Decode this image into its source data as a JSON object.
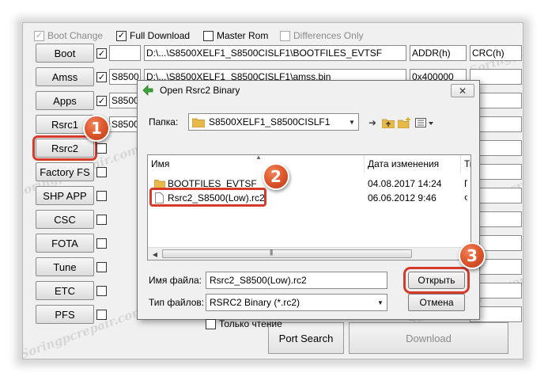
{
  "watermark": "Soringpcrepair.com",
  "options": [
    {
      "label": "Boot Change",
      "checked": true,
      "enabled": false
    },
    {
      "label": "Full Download",
      "checked": true,
      "enabled": true
    },
    {
      "label": "Master Rom",
      "checked": false,
      "enabled": true
    },
    {
      "label": "Differences Only",
      "checked": false,
      "enabled": false
    }
  ],
  "check_mark": "✓",
  "rows": [
    {
      "button": "Boot",
      "checked": true,
      "prefix": "",
      "path": "D:\\...\\S8500XELF1_S8500CISLF1\\BOOTFILES_EVTSF",
      "col_a": "ADDR(h)",
      "col_b": "CRC(h)"
    },
    {
      "button": "Amss",
      "checked": true,
      "prefix": "S8500",
      "path": "D:\\...\\S8500XELF1_S8500CISLF1\\amss.bin",
      "col_a": "0x400000",
      "col_b": ""
    },
    {
      "button": "Apps",
      "checked": true,
      "prefix": "S8500",
      "path": "",
      "col_a": "",
      "col_b": ""
    },
    {
      "button": "Rsrc1",
      "checked": false,
      "prefix": "S8500",
      "path": "",
      "col_a": "",
      "col_b": ""
    },
    {
      "button": "Rsrc2",
      "checked": false,
      "prefix": "",
      "path": "",
      "col_a": "",
      "col_b": ""
    },
    {
      "button": "Factory FS",
      "checked": false,
      "prefix": "",
      "path": "",
      "col_a": "",
      "col_b": ""
    },
    {
      "button": "SHP APP",
      "checked": false,
      "prefix": "",
      "path": "",
      "col_a": "",
      "col_b": ""
    },
    {
      "button": "CSC",
      "checked": false,
      "prefix": "",
      "path": "",
      "col_a": "",
      "col_b": ""
    },
    {
      "button": "FOTA",
      "checked": false,
      "prefix": "",
      "path": "",
      "col_a": "",
      "col_b": ""
    },
    {
      "button": "Tune",
      "checked": false,
      "prefix": "",
      "path": "",
      "col_a": "",
      "col_b": ""
    },
    {
      "button": "ETC",
      "checked": false,
      "prefix": "",
      "path": "",
      "col_a": "",
      "col_b": ""
    },
    {
      "button": "PFS",
      "checked": false,
      "prefix": "",
      "path": "",
      "col_a": "",
      "col_b": ""
    }
  ],
  "bottom_buttons": {
    "port_search": "Port Search",
    "download": "Download"
  },
  "dialog": {
    "title": "Open Rsrc2 Binary",
    "close": "✕",
    "folder_label": "Папка:",
    "folder_value": "S8500XELF1_S8500CISLF1",
    "columns": {
      "name": "Имя",
      "date": "Дата изменения",
      "type": "Ти"
    },
    "files": [
      {
        "name": "BOOTFILES_EVTSF",
        "date": "04.08.2017 14:24",
        "type": "П",
        "kind": "folder"
      },
      {
        "name": "Rsrc2_S8500(Low).rc2",
        "date": "06.06.2012 9:46",
        "type": "Ф",
        "kind": "file"
      }
    ],
    "filename_label": "Имя файла:",
    "filename_value": "Rsrc2_S8500(Low).rc2",
    "filetype_label": "Тип файлов:",
    "filetype_value": "RSRC2 Binary (*.rc2)",
    "readonly_label": "Только чтение",
    "open_button": "Открыть",
    "cancel_button": "Отмена"
  },
  "step_badges": [
    "1",
    "2",
    "3"
  ],
  "colors": {
    "highlight": "#d63a2a",
    "badge": "#e05a2e",
    "folder": "#e8b848"
  }
}
